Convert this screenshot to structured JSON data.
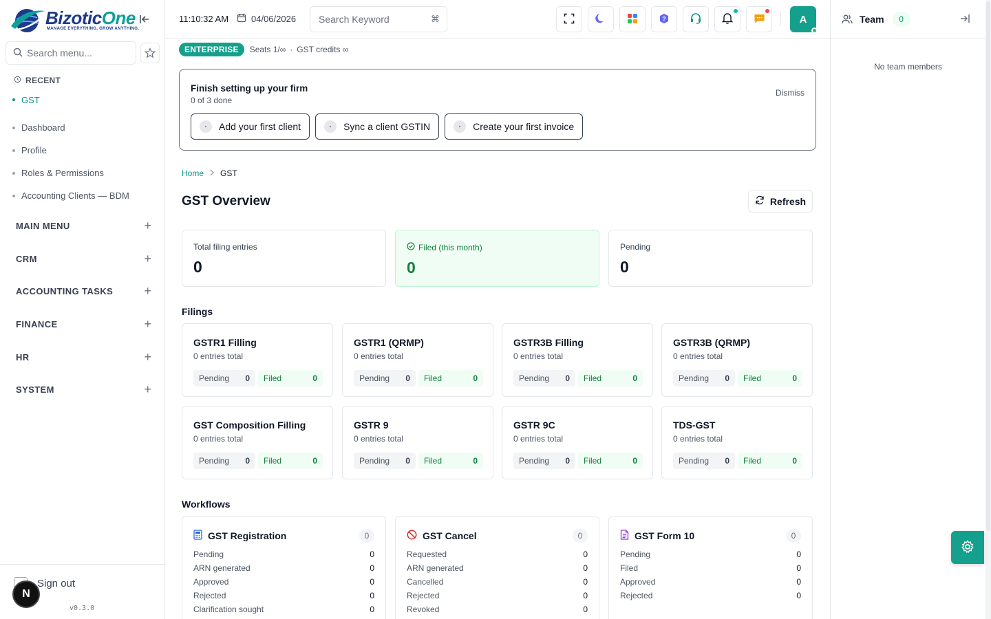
{
  "brand": {
    "name_part1": "Bizotic",
    "name_part2": "One",
    "tagline": "MANAGE EVERYTHING, GROW ANYTHING."
  },
  "sidebar": {
    "search_placeholder": "Search menu...",
    "recent_heading": "RECENT",
    "recent": [
      "GST",
      "Dashboard",
      "Profile",
      "Roles & Permissions",
      "Accounting Clients — BDM"
    ],
    "groups": [
      "MAIN MENU",
      "CRM",
      "ACCOUNTING TASKS",
      "FINANCE",
      "HR",
      "SYSTEM"
    ],
    "signout": "Sign out",
    "avatar_letter": "N",
    "version": "v0.3.0"
  },
  "topbar": {
    "time": "11:10:32 AM",
    "date": "04/06/2026",
    "search_placeholder": "Search Keyword",
    "shortcut": "⌘",
    "avatar_letter": "A"
  },
  "team_panel": {
    "title": "Team",
    "count": "0",
    "empty": "No team members"
  },
  "plan": {
    "tier": "ENTERPRISE",
    "seats": "Seats 1/∞",
    "separator": "·",
    "credits": "GST credits ∞"
  },
  "setup": {
    "title": "Finish setting up your firm",
    "progress": "0 of 3 done",
    "dismiss": "Dismiss",
    "actions": [
      "Add your first client",
      "Sync a client GSTIN",
      "Create your first invoice"
    ]
  },
  "breadcrumb": {
    "home": "Home",
    "current": "GST"
  },
  "page": {
    "title": "GST Overview",
    "refresh": "Refresh"
  },
  "stats": [
    {
      "label": "Total filing entries",
      "value": "0"
    },
    {
      "label": "Filed (this month)",
      "value": "0"
    },
    {
      "label": "Pending",
      "value": "0"
    }
  ],
  "filings_heading": "Filings",
  "filings": [
    {
      "title": "GSTR1 Filling",
      "subtitle": "0 entries total",
      "pending_label": "Pending",
      "pending": "0",
      "filed_label": "Filed",
      "filed": "0"
    },
    {
      "title": "GSTR1 (QRMP)",
      "subtitle": "0 entries total",
      "pending_label": "Pending",
      "pending": "0",
      "filed_label": "Filed",
      "filed": "0"
    },
    {
      "title": "GSTR3B Filling",
      "subtitle": "0 entries total",
      "pending_label": "Pending",
      "pending": "0",
      "filed_label": "Filed",
      "filed": "0"
    },
    {
      "title": "GSTR3B (QRMP)",
      "subtitle": "0 entries total",
      "pending_label": "Pending",
      "pending": "0",
      "filed_label": "Filed",
      "filed": "0"
    },
    {
      "title": "GST Composition Filling",
      "subtitle": "0 entries total",
      "pending_label": "Pending",
      "pending": "0",
      "filed_label": "Filed",
      "filed": "0"
    },
    {
      "title": "GSTR 9",
      "subtitle": "0 entries total",
      "pending_label": "Pending",
      "pending": "0",
      "filed_label": "Filed",
      "filed": "0"
    },
    {
      "title": "GSTR 9C",
      "subtitle": "0 entries total",
      "pending_label": "Pending",
      "pending": "0",
      "filed_label": "Filed",
      "filed": "0"
    },
    {
      "title": "TDS-GST",
      "subtitle": "0 entries total",
      "pending_label": "Pending",
      "pending": "0",
      "filed_label": "Filed",
      "filed": "0"
    }
  ],
  "workflows_heading": "Workflows",
  "workflows": [
    {
      "title": "GST Registration",
      "count": "0",
      "icon": "calculator-icon",
      "rows": [
        [
          "Pending",
          "0"
        ],
        [
          "ARN generated",
          "0"
        ],
        [
          "Approved",
          "0"
        ],
        [
          "Rejected",
          "0"
        ],
        [
          "Clarification sought",
          "0"
        ]
      ]
    },
    {
      "title": "GST Cancel",
      "count": "0",
      "icon": "ban-icon",
      "rows": [
        [
          "Requested",
          "0"
        ],
        [
          "ARN generated",
          "0"
        ],
        [
          "Cancelled",
          "0"
        ],
        [
          "Rejected",
          "0"
        ],
        [
          "Revoked",
          "0"
        ]
      ]
    },
    {
      "title": "GST Form 10",
      "count": "0",
      "icon": "document-icon",
      "rows": [
        [
          "Pending",
          "0"
        ],
        [
          "Filed",
          "0"
        ],
        [
          "Approved",
          "0"
        ],
        [
          "Rejected",
          "0"
        ]
      ]
    }
  ],
  "colors": {
    "brand_teal": "#14a08c",
    "brand_navy": "#1e3a8a",
    "filed_green": "#15803d"
  }
}
